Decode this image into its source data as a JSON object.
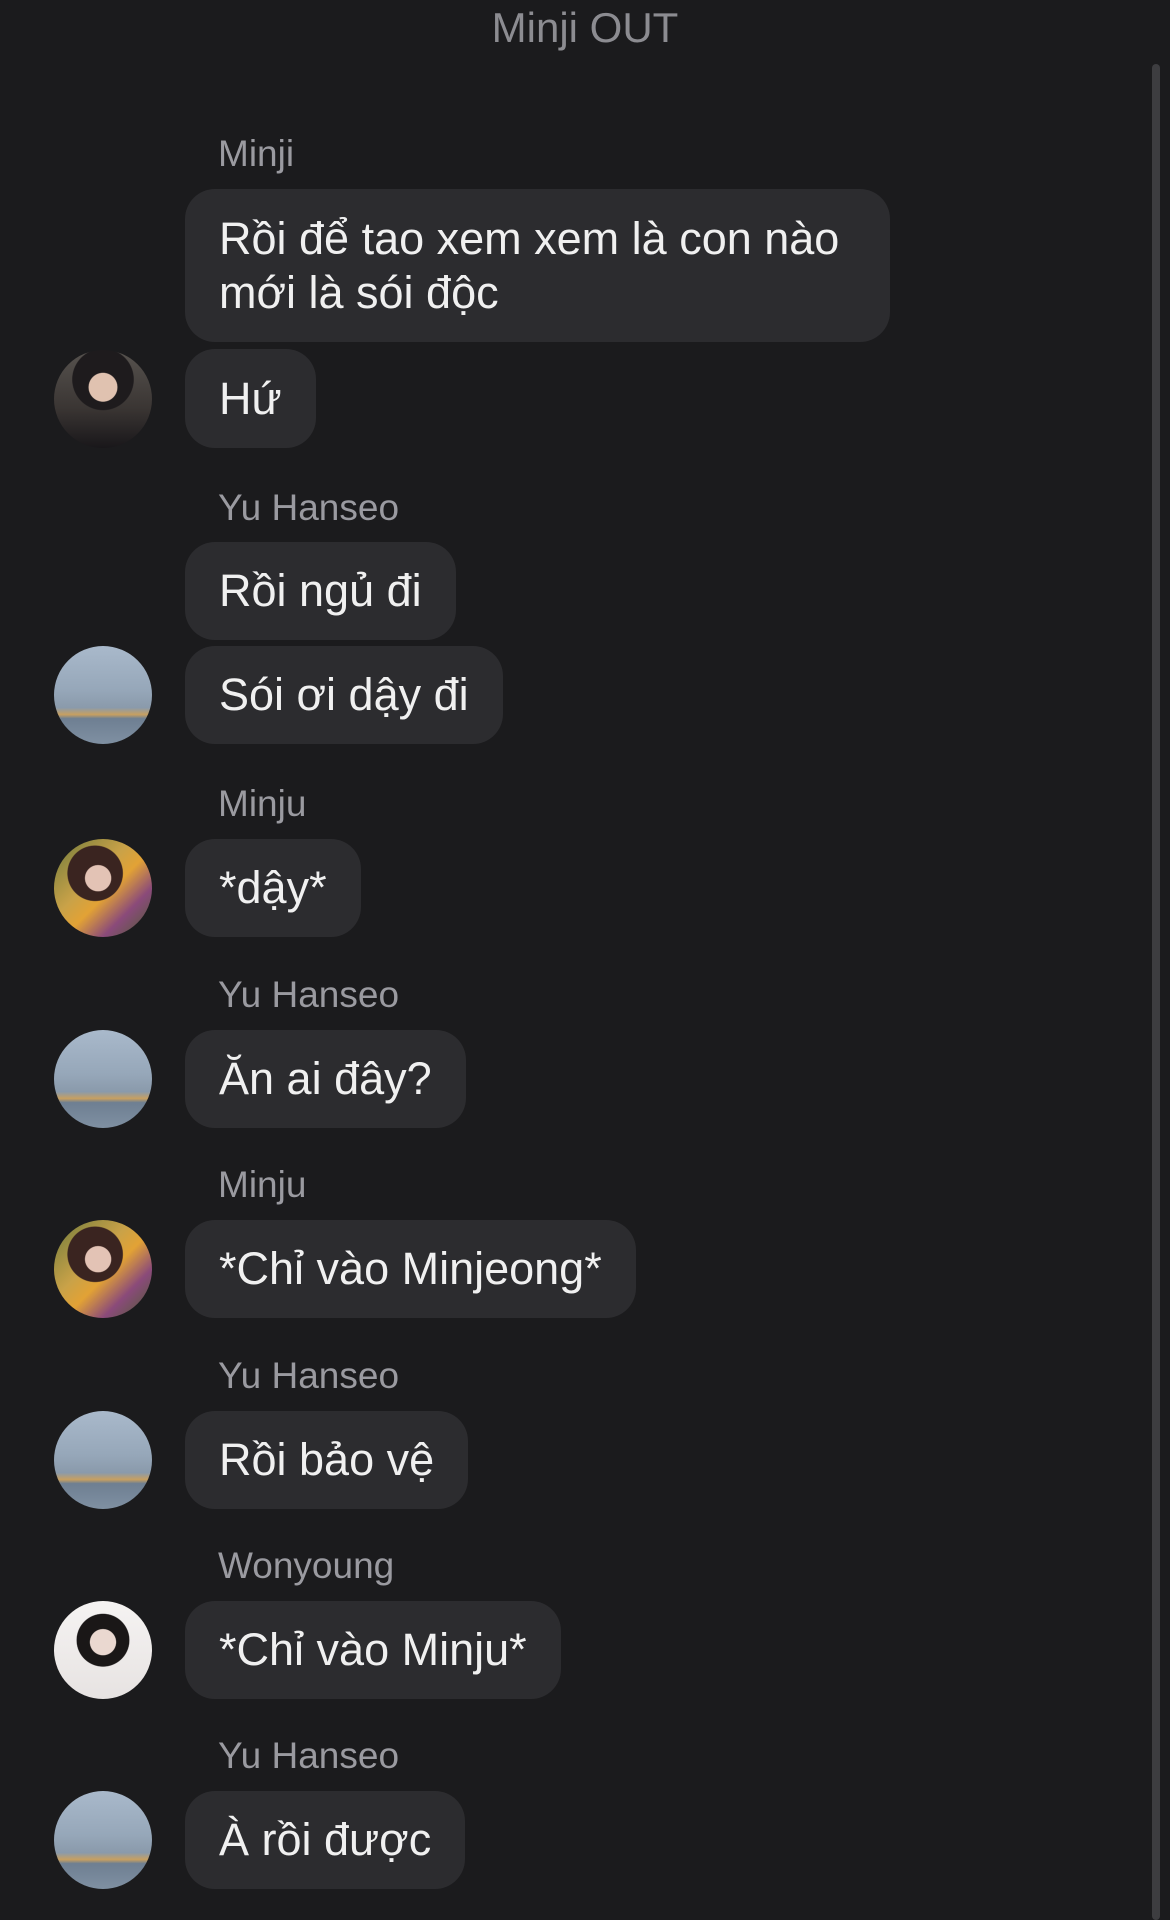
{
  "header": {
    "title": "Minji OUT"
  },
  "messages": [
    {
      "sender": "Minji",
      "bubbles": [
        "Rồi để tao xem xem là con nào mới là sói độc",
        "Hứ"
      ]
    },
    {
      "sender": "Yu Hanseo",
      "bubbles": [
        "Rồi ngủ đi",
        "Sói ơi dậy đi"
      ]
    },
    {
      "sender": "Minju",
      "bubbles": [
        "*dậy*"
      ]
    },
    {
      "sender": "Yu Hanseo",
      "bubbles": [
        "Ăn ai đây?"
      ]
    },
    {
      "sender": "Minju",
      "bubbles": [
        "*Chỉ vào Minjeong*"
      ]
    },
    {
      "sender": "Yu Hanseo",
      "bubbles": [
        "Rồi bảo vệ"
      ]
    },
    {
      "sender": "Wonyoung",
      "bubbles": [
        "*Chỉ vào Minju*"
      ]
    },
    {
      "sender": "Yu Hanseo",
      "bubbles": [
        "À rồi được"
      ]
    }
  ],
  "colors": {
    "background": "#1b1b1d",
    "bubble": "#2c2c2f",
    "sender_text": "#9a9aa0",
    "title_text": "#8c8c91"
  },
  "icons": {
    "avatar_minji": "profile-photo-minji",
    "avatar_yu_hanseo": "profile-photo-sky",
    "avatar_minju": "profile-photo-minju",
    "avatar_wonyoung": "profile-photo-wonyoung"
  }
}
